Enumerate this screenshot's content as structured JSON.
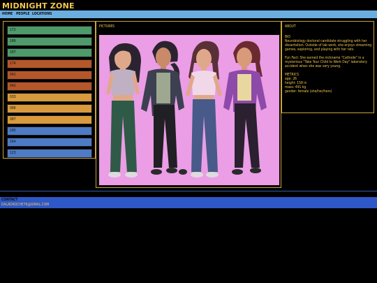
{
  "header": {
    "title": "MIDNIGHT ZONE"
  },
  "nav": {
    "items": [
      "HOME",
      "PEOPLE",
      "LOCATIONS"
    ]
  },
  "list": {
    "items": [
      {
        "label": "172",
        "color": "#4e9a6a"
      },
      {
        "label": "186",
        "color": "#4e9a6a"
      },
      {
        "label": "187",
        "color": "#4e9a6a"
      },
      {
        "label": "174",
        "color": "#b5572a"
      },
      {
        "label": "041",
        "color": "#b5572a"
      },
      {
        "label": "042",
        "color": "#b5572a"
      },
      {
        "label": "033",
        "color": "#d89a3c"
      },
      {
        "label": "086",
        "color": "#d89a3c"
      },
      {
        "label": "087",
        "color": "#d89a3c"
      },
      {
        "label": "185",
        "color": "#4e7bc6"
      },
      {
        "label": "164",
        "color": "#4e7bc6"
      },
      {
        "label": "123",
        "color": "#4e7bc6"
      }
    ]
  },
  "pictures": {
    "label": "PICTURES"
  },
  "about": {
    "label": "ABOUT",
    "bio_heading": "BIO",
    "bio": "Neurobiology doctoral candidate struggling with her dissertation. Outside of lab work, she enjoys streaming games, exploring, and playing with her rats.",
    "fun_fact": "Fun Fact: She earned the nickname \"Cathode\" in a mysterious \"Take Your Child to Work Day\" laboratory accident when she was very young.",
    "metrics_heading": "METRICS",
    "metrics": [
      "age: 26",
      "height: 158 in",
      "mass: 491 kg",
      "gender: female (she/her/hers)"
    ]
  },
  "footer": {
    "contact_label": "CONTACT",
    "email": "DALADROCHE76@GMAIL.COM"
  }
}
